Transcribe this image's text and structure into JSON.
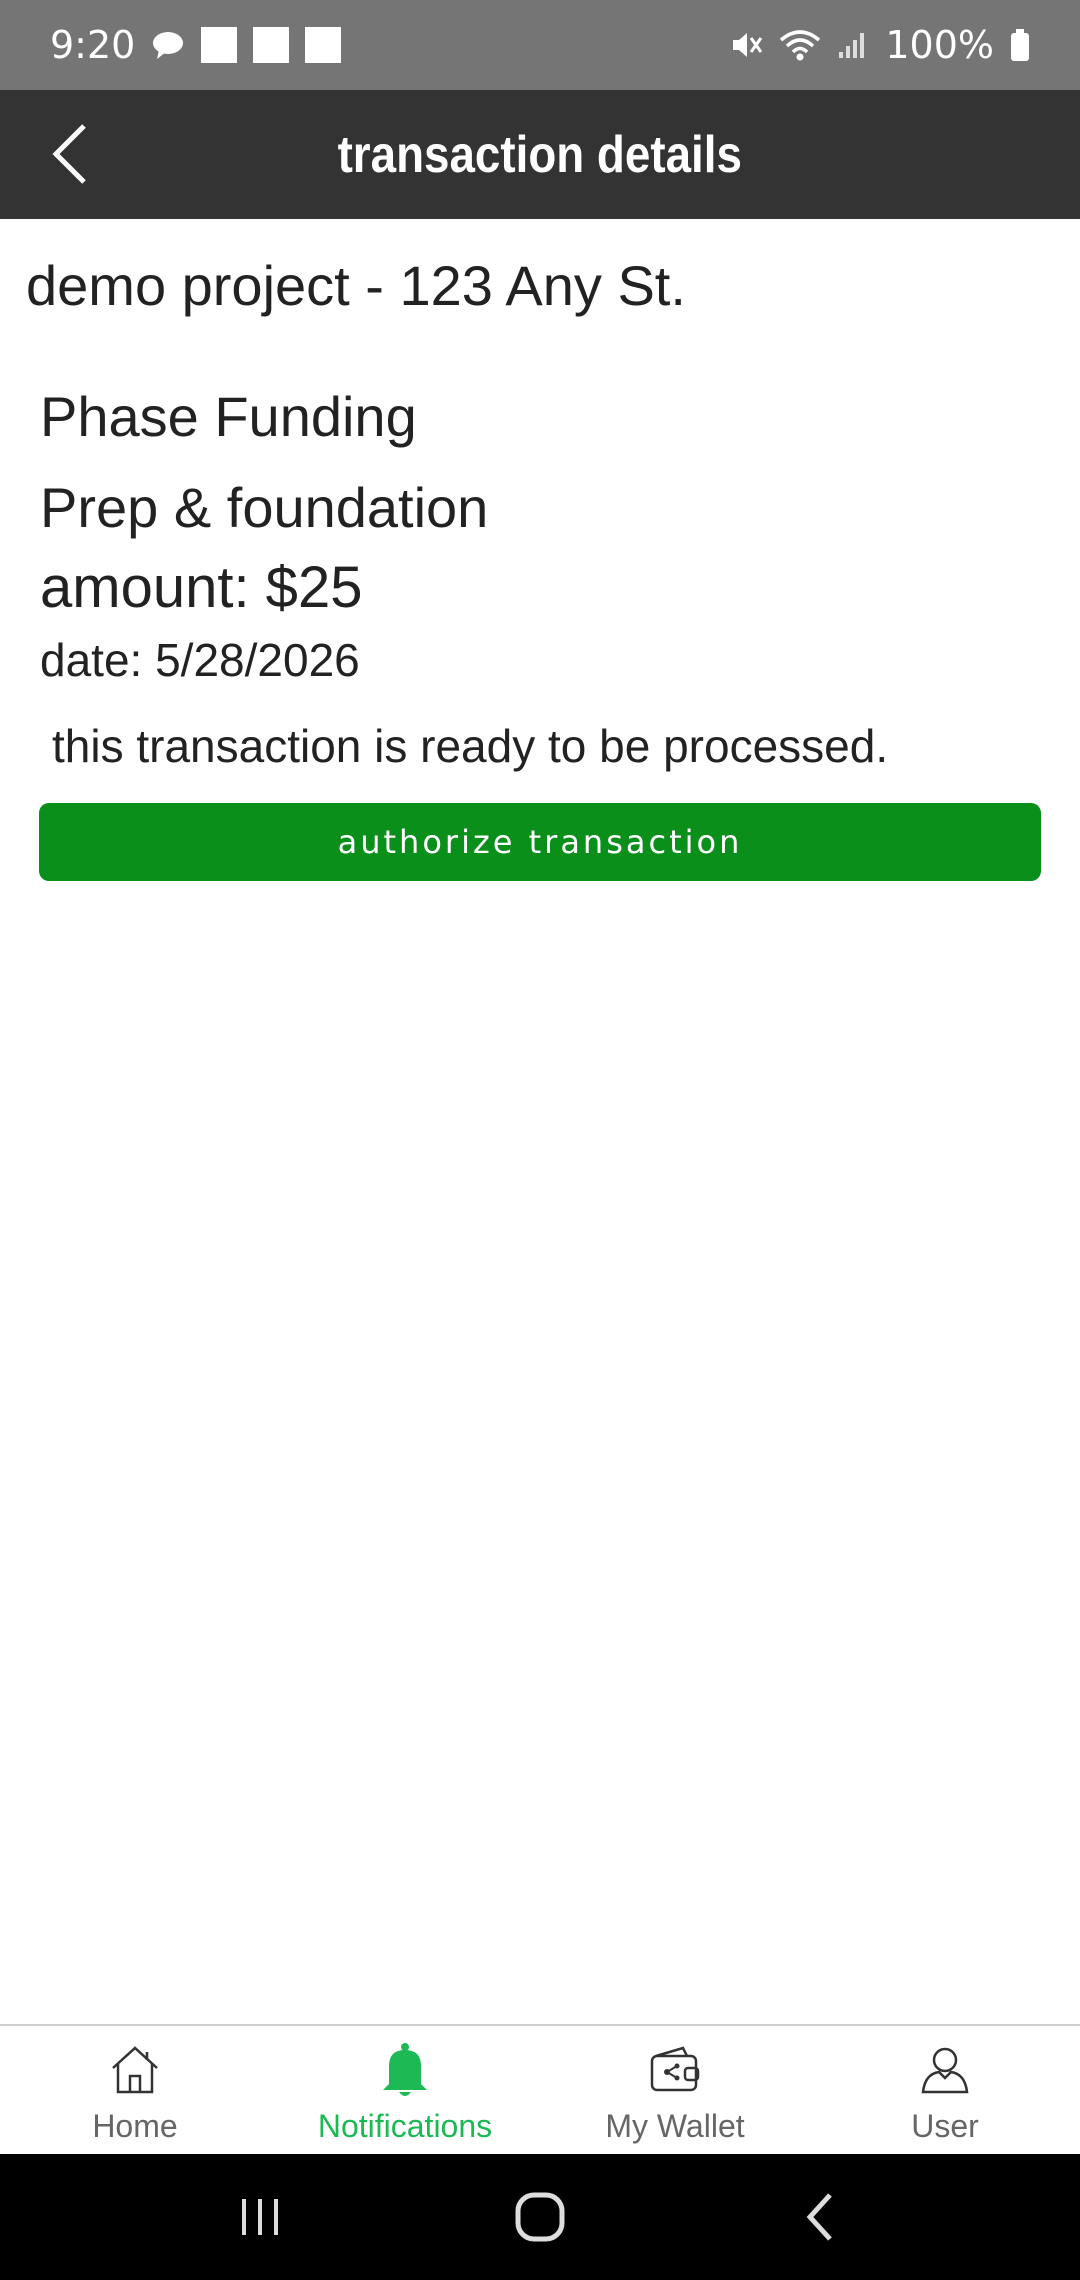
{
  "status_bar": {
    "time": "9:20",
    "battery": "100%",
    "icons": [
      "chat-bubble-icon",
      "mute-icon",
      "wifi-icon",
      "signal-icon",
      "battery-icon"
    ]
  },
  "header": {
    "title": "transaction details",
    "back_icon": "chevron-left-icon"
  },
  "transaction": {
    "project": "demo project - 123 Any St.",
    "type": "Phase Funding",
    "phase": "Prep & foundation",
    "amount": "amount: $25",
    "date": "date: 5/28/2026",
    "status_message": "this transaction is ready to be processed.",
    "authorize_label": "authorize transaction"
  },
  "bottom_nav": {
    "items": [
      {
        "label": "Home",
        "icon": "home-icon",
        "active": false
      },
      {
        "label": "Notifications",
        "icon": "bell-icon",
        "active": true
      },
      {
        "label": "My Wallet",
        "icon": "wallet-icon",
        "active": false
      },
      {
        "label": "User",
        "icon": "user-icon",
        "active": false
      }
    ]
  },
  "colors": {
    "status_bar": "#757575",
    "app_bar": "#333333",
    "primary_button": "#0a8f1b",
    "active_nav": "#1db954",
    "inactive_nav": "#666666"
  }
}
